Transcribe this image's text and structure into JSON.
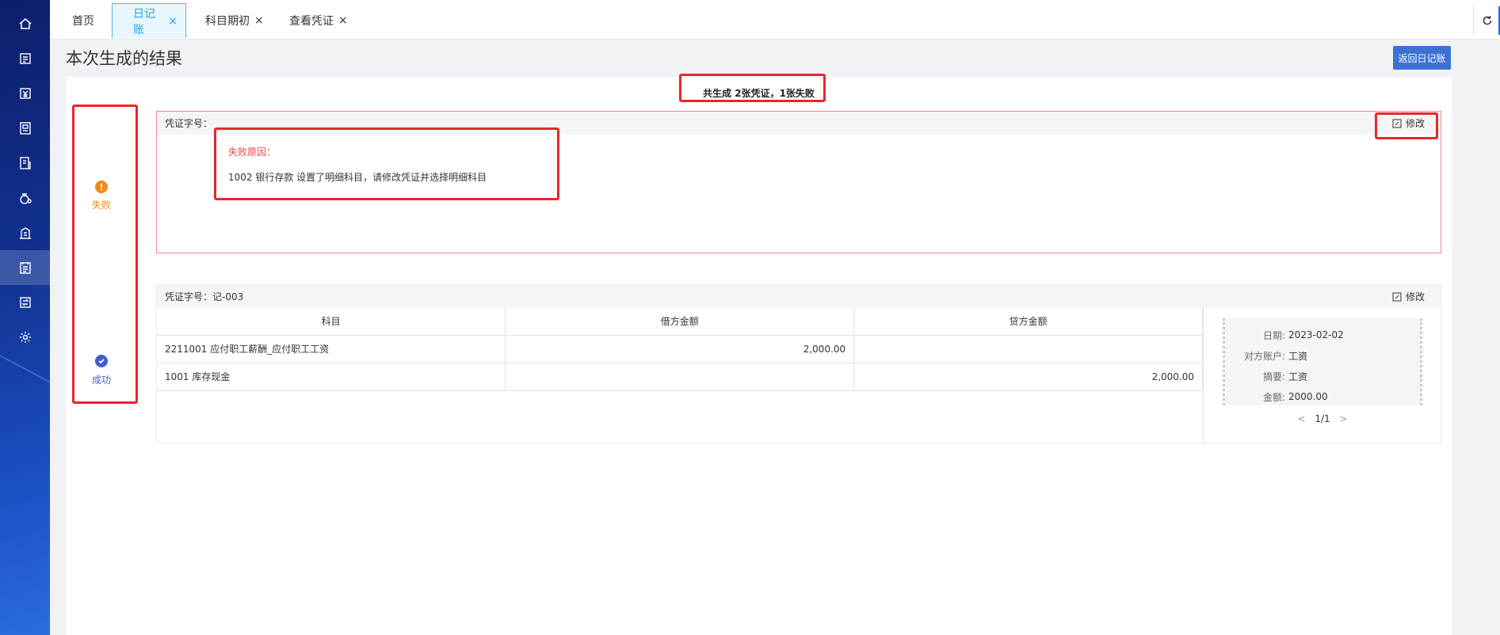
{
  "tabs": [
    {
      "label": "首页",
      "closable": false
    },
    {
      "label": "日记账",
      "closable": true,
      "active": true
    },
    {
      "label": "科目期初",
      "closable": true
    },
    {
      "label": "查看凭证",
      "closable": true
    }
  ],
  "close_glyph": "×",
  "sidebar_icons": [
    "home-icon",
    "document-icon",
    "yen-icon",
    "ledger-icon",
    "report-icon",
    "money-bag-icon",
    "building-icon",
    "voucher-icon",
    "exchange-icon",
    "gear-icon"
  ],
  "page": {
    "title": "本次生成的结果",
    "back_button": "返回日记账",
    "summary": "共生成 2张凭证，1张失败"
  },
  "status": {
    "fail_label": "失败",
    "success_label": "成功",
    "fail_color": "#f08c1a",
    "success_color": "#3d5fd0"
  },
  "fail_card": {
    "voucher_label": "凭证字号：",
    "edit_label": "修改",
    "reason_title": "失败原因：",
    "reason_message": "1002 银行存款 设置了明细科目，请修改凭证并选择明细科目"
  },
  "ok_card": {
    "voucher_label": "凭证字号：记-003",
    "edit_label": "修改",
    "columns": [
      "科目",
      "借方金额",
      "贷方金额"
    ],
    "rows": [
      {
        "account": "2211001 应付职工薪酬_应付职工工资",
        "debit": "2,000.00",
        "credit": ""
      },
      {
        "account": "1001 库存现金",
        "debit": "",
        "credit": "2,000.00"
      }
    ],
    "info": [
      {
        "key": "日期:",
        "value": "2023-02-02"
      },
      {
        "key": "对方账户:",
        "value": "工资"
      },
      {
        "key": "摘要:",
        "value": "工资"
      },
      {
        "key": "金额:",
        "value": "2000.00"
      }
    ],
    "pager": {
      "prev": "<",
      "current": "1/1",
      "next": ">"
    }
  },
  "colors": {
    "accent": "#3d71d6",
    "tab_active": "#19a5e3",
    "highlight": "#e8262e"
  }
}
